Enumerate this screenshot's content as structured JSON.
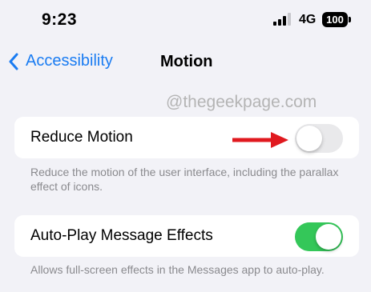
{
  "status_bar": {
    "time": "9:23",
    "network": "4G",
    "battery": "100"
  },
  "nav": {
    "back_label": "Accessibility",
    "title": "Motion"
  },
  "watermark": "@thegeekpage.com",
  "settings": [
    {
      "label": "Reduce Motion",
      "toggle": "off",
      "description": "Reduce the motion of the user interface, including the parallax effect of icons."
    },
    {
      "label": "Auto-Play Message Effects",
      "toggle": "on",
      "description": "Allows full-screen effects in the Messages app to auto-play."
    }
  ],
  "colors": {
    "accent": "#1a7cf2",
    "toggle_on": "#34c759",
    "toggle_off": "#e9e9eb",
    "annotation_arrow": "#e0191f"
  },
  "icons": {
    "back": "chevron-left-icon",
    "signal": "cellular-signal-icon",
    "battery": "battery-icon",
    "annotation": "red-arrow-icon"
  }
}
